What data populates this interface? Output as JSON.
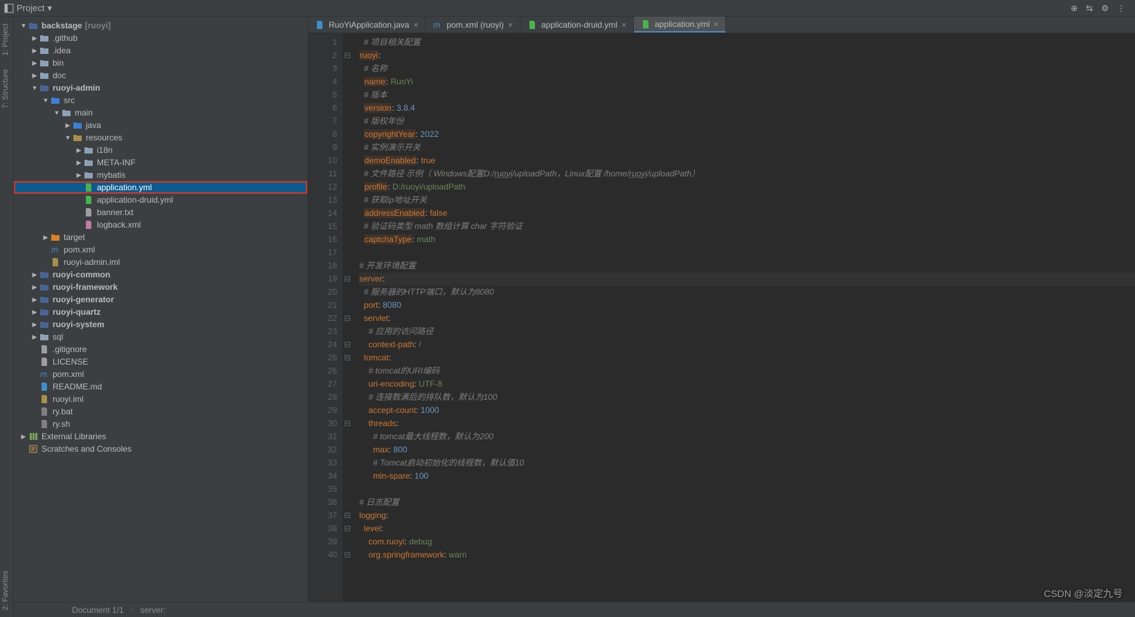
{
  "topbar": {
    "project_label": "Project",
    "tools": [
      "⟳",
      "⇅",
      "⚙",
      "⋮"
    ]
  },
  "sidebar_vtabs": {
    "project": "1: Project",
    "structure": "7: Structure",
    "favorites": "2: Favorites"
  },
  "tree": {
    "root": "backstage",
    "root_bracket": "[ruoyi]",
    "items": [
      {
        "d": 0,
        "t": "▼",
        "i": "mod",
        "n": "backstage",
        "b": "[ruoyi]",
        "bold": true
      },
      {
        "d": 1,
        "t": "▶",
        "i": "dir",
        "n": ".github"
      },
      {
        "d": 1,
        "t": "▶",
        "i": "dir",
        "n": ".idea"
      },
      {
        "d": 1,
        "t": "▶",
        "i": "dir",
        "n": "bin"
      },
      {
        "d": 1,
        "t": "▶",
        "i": "dir",
        "n": "doc"
      },
      {
        "d": 1,
        "t": "▼",
        "i": "mod",
        "n": "ruoyi-admin",
        "bold": true
      },
      {
        "d": 2,
        "t": "▼",
        "i": "srcdir",
        "n": "src"
      },
      {
        "d": 3,
        "t": "▼",
        "i": "dir",
        "n": "main"
      },
      {
        "d": 4,
        "t": "▶",
        "i": "srcdir",
        "n": "java"
      },
      {
        "d": 4,
        "t": "▼",
        "i": "resdir",
        "n": "resources"
      },
      {
        "d": 5,
        "t": "▶",
        "i": "dir",
        "n": "i18n"
      },
      {
        "d": 5,
        "t": "▶",
        "i": "dir",
        "n": "META-INF"
      },
      {
        "d": 5,
        "t": "▶",
        "i": "dir",
        "n": "mybatis"
      },
      {
        "d": 5,
        "t": "",
        "i": "yml",
        "n": "application.yml",
        "sel": true,
        "hl": true
      },
      {
        "d": 5,
        "t": "",
        "i": "yml",
        "n": "application-druid.yml"
      },
      {
        "d": 5,
        "t": "",
        "i": "txt",
        "n": "banner.txt"
      },
      {
        "d": 5,
        "t": "",
        "i": "xml",
        "n": "logback.xml"
      },
      {
        "d": 2,
        "t": "▶",
        "i": "target",
        "n": "target"
      },
      {
        "d": 2,
        "t": "",
        "i": "pom",
        "n": "pom.xml"
      },
      {
        "d": 2,
        "t": "",
        "i": "iml",
        "n": "ruoyi-admin.iml"
      },
      {
        "d": 1,
        "t": "▶",
        "i": "mod",
        "n": "ruoyi-common",
        "bold": true
      },
      {
        "d": 1,
        "t": "▶",
        "i": "mod",
        "n": "ruoyi-framework",
        "bold": true
      },
      {
        "d": 1,
        "t": "▶",
        "i": "mod",
        "n": "ruoyi-generator",
        "bold": true
      },
      {
        "d": 1,
        "t": "▶",
        "i": "mod",
        "n": "ruoyi-quartz",
        "bold": true
      },
      {
        "d": 1,
        "t": "▶",
        "i": "mod",
        "n": "ruoyi-system",
        "bold": true
      },
      {
        "d": 1,
        "t": "▶",
        "i": "dir",
        "n": "sql"
      },
      {
        "d": 1,
        "t": "",
        "i": "txt",
        "n": ".gitignore"
      },
      {
        "d": 1,
        "t": "",
        "i": "txt",
        "n": "LICENSE"
      },
      {
        "d": 1,
        "t": "",
        "i": "pom",
        "n": "pom.xml"
      },
      {
        "d": 1,
        "t": "",
        "i": "md",
        "n": "README.md"
      },
      {
        "d": 1,
        "t": "",
        "i": "iml",
        "n": "ruoyi.iml"
      },
      {
        "d": 1,
        "t": "",
        "i": "bat",
        "n": "ry.bat"
      },
      {
        "d": 1,
        "t": "",
        "i": "sh",
        "n": "ry.sh"
      },
      {
        "d": 0,
        "t": "▶",
        "i": "lib",
        "n": "External Libraries"
      },
      {
        "d": 0,
        "t": "",
        "i": "scr",
        "n": "Scratches and Consoles"
      }
    ]
  },
  "tabs": [
    {
      "i": "java",
      "n": "RuoYiApplication.java"
    },
    {
      "i": "pom",
      "n": "pom.xml (ruoyi)"
    },
    {
      "i": "yml",
      "n": "application-druid.yml"
    },
    {
      "i": "yml",
      "n": "application.yml",
      "active": true
    }
  ],
  "code": {
    "lines": [
      {
        "no": 1,
        "f": "",
        "h": "  <span class='c-cmt'># 项目相关配置</span>"
      },
      {
        "no": 2,
        "f": "⊟",
        "h": "<span class='c-keybg'>ruoyi</span>:"
      },
      {
        "no": 3,
        "f": "",
        "h": "  <span class='c-cmt'># 名称</span>"
      },
      {
        "no": 4,
        "f": "",
        "h": "  <span class='c-keybg'>name</span>: <span class='c-str'>RuoYi</span>"
      },
      {
        "no": 5,
        "f": "",
        "h": "  <span class='c-cmt'># 版本</span>"
      },
      {
        "no": 6,
        "f": "",
        "h": "  <span class='c-keybg'>version</span>: <span class='c-num'>3.8.4</span>"
      },
      {
        "no": 7,
        "f": "",
        "h": "  <span class='c-cmt'># 版权年份</span>"
      },
      {
        "no": 8,
        "f": "",
        "h": "  <span class='c-keybg'>copyrightYear</span>: <span class='c-num'>2022</span>"
      },
      {
        "no": 9,
        "f": "",
        "h": "  <span class='c-cmt'># 实例演示开关</span>"
      },
      {
        "no": 10,
        "f": "",
        "h": "  <span class='c-keybg'>demoEnabled</span>: <span class='c-key'>true</span>"
      },
      {
        "no": 11,
        "f": "",
        "h": "  <span class='c-cmt'># 文件路径 示例（ Windows配置D:/<span class='c-under'>ruoyi</span>/uploadPath，Linux配置 /home/<span class='c-under'>ruoyi</span>/uploadPath）</span>"
      },
      {
        "no": 12,
        "f": "",
        "h": "  <span class='c-keybg'>profile</span>: <span class='c-str'>D:/ruoyi/uploadPath</span>"
      },
      {
        "no": 13,
        "f": "",
        "h": "  <span class='c-cmt'># 获取ip地址开关</span>"
      },
      {
        "no": 14,
        "f": "",
        "h": "  <span class='c-keybg'>addressEnabled</span>: <span class='c-key'>false</span>"
      },
      {
        "no": 15,
        "f": "",
        "h": "  <span class='c-cmt'># 验证码类型 math 数组计算 char 字符验证</span>"
      },
      {
        "no": 16,
        "f": "",
        "h": "  <span class='c-keybg'>captchaType</span>: <span class='c-str'>math</span>"
      },
      {
        "no": 17,
        "f": "",
        "h": ""
      },
      {
        "no": 18,
        "f": "",
        "h": "<span class='c-cmt'># 开发环境配置</span>"
      },
      {
        "no": 19,
        "f": "⊟",
        "h": "<span class='c-key'>server</span>:",
        "cur": true
      },
      {
        "no": 20,
        "f": "",
        "h": "  <span class='c-cmt'># 服务器的HTTP端口，默认为8080</span>"
      },
      {
        "no": 21,
        "f": "",
        "h": "  <span class='c-key'>port</span>: <span class='c-num'>8080</span>"
      },
      {
        "no": 22,
        "f": "⊟",
        "h": "  <span class='c-key'>servlet</span>:"
      },
      {
        "no": 23,
        "f": "",
        "h": "    <span class='c-cmt'># 应用的访问路径</span>"
      },
      {
        "no": 24,
        "f": "⊟",
        "h": "    <span class='c-key'>context-path</span>: <span class='c-str'>/</span>"
      },
      {
        "no": 25,
        "f": "⊟",
        "h": "  <span class='c-key'>tomcat</span>:"
      },
      {
        "no": 26,
        "f": "",
        "h": "    <span class='c-cmt'># tomcat的URI编码</span>"
      },
      {
        "no": 27,
        "f": "",
        "h": "    <span class='c-key'>uri-encoding</span>: <span class='c-str'>UTF-8</span>"
      },
      {
        "no": 28,
        "f": "",
        "h": "    <span class='c-cmt'># 连接数满后的排队数，默认为100</span>"
      },
      {
        "no": 29,
        "f": "",
        "h": "    <span class='c-key'>accept-count</span>: <span class='c-num'>1000</span>"
      },
      {
        "no": 30,
        "f": "⊟",
        "h": "    <span class='c-key'>threads</span>:"
      },
      {
        "no": 31,
        "f": "",
        "h": "      <span class='c-cmt'># tomcat最大线程数，默认为200</span>"
      },
      {
        "no": 32,
        "f": "",
        "h": "      <span class='c-key'>max</span>: <span class='c-num'>800</span>"
      },
      {
        "no": 33,
        "f": "",
        "h": "      <span class='c-cmt'># Tomcat启动初始化的线程数，默认值10</span>"
      },
      {
        "no": 34,
        "f": "",
        "h": "      <span class='c-key'>min-spare</span>: <span class='c-num'>100</span>"
      },
      {
        "no": 35,
        "f": "",
        "h": ""
      },
      {
        "no": 36,
        "f": "",
        "h": "<span class='c-cmt'># 日志配置</span>"
      },
      {
        "no": 37,
        "f": "⊟",
        "h": "<span class='c-key'>logging</span>:"
      },
      {
        "no": 38,
        "f": "⊟",
        "h": "  <span class='c-key'>level</span>:"
      },
      {
        "no": 39,
        "f": "",
        "h": "    <span class='c-key'>com.ruoyi</span>: <span class='c-str'>debug</span>"
      },
      {
        "no": 40,
        "f": "⊟",
        "h": "    <span class='c-key'>org.springframework</span>: <span class='c-str'>warn</span>"
      }
    ]
  },
  "status": {
    "doc": "Document 1/1",
    "crumb": "server:"
  },
  "watermark": "CSDN @淡定九号"
}
